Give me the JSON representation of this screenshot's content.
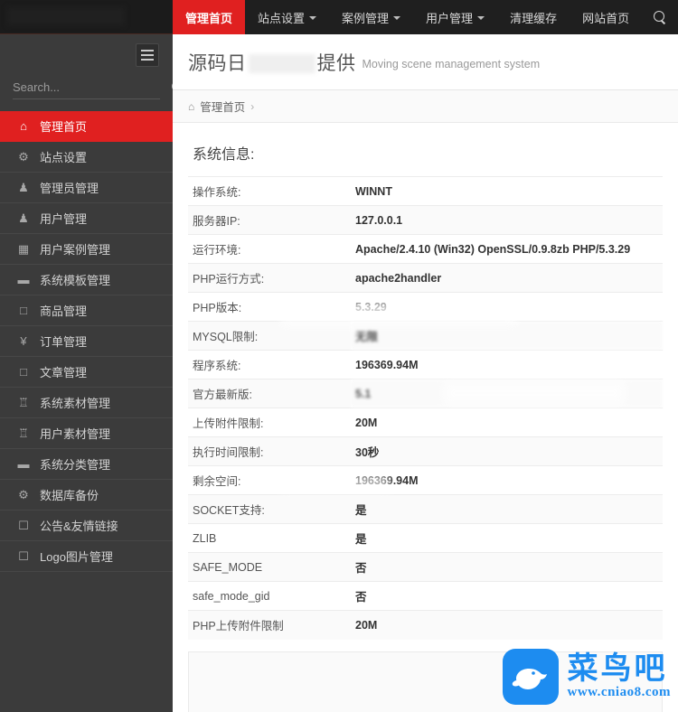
{
  "brand": {
    "accent": "#e02020",
    "sidebar_bg": "#3b3b3b",
    "topnav_bg": "#1f1f1f",
    "watermark_blue": "#1d8cf0"
  },
  "sidebar": {
    "search_placeholder": "Search...",
    "menu": [
      {
        "label": "管理首页",
        "icon": "home-icon",
        "glyph": "⌂",
        "active": true
      },
      {
        "label": "站点设置",
        "icon": "gears-icon",
        "glyph": "⚙",
        "active": false
      },
      {
        "label": "管理员管理",
        "icon": "user-icon",
        "glyph": "♟",
        "active": false
      },
      {
        "label": "用户管理",
        "icon": "user-icon",
        "glyph": "♟",
        "active": false
      },
      {
        "label": "用户案例管理",
        "icon": "grid-icon",
        "glyph": "▦",
        "active": false
      },
      {
        "label": "系统模板管理",
        "icon": "briefcase-icon",
        "glyph": "▬",
        "active": false
      },
      {
        "label": "商品管理",
        "icon": "box-caret-icon",
        "glyph": "□",
        "active": false
      },
      {
        "label": "订单管理",
        "icon": "yen-icon",
        "glyph": "¥",
        "active": false
      },
      {
        "label": "文章管理",
        "icon": "box-caret-icon",
        "glyph": "□",
        "active": false
      },
      {
        "label": "系统素材管理",
        "icon": "trophy-icon",
        "glyph": "♖",
        "active": false
      },
      {
        "label": "用户素材管理",
        "icon": "trophy-icon",
        "glyph": "♖",
        "active": false
      },
      {
        "label": "系统分类管理",
        "icon": "briefcase-icon",
        "glyph": "▬",
        "active": false
      },
      {
        "label": "数据库备份",
        "icon": "gears-icon",
        "glyph": "⚙",
        "active": false
      },
      {
        "label": "公告&友情链接",
        "icon": "bookmark-icon",
        "glyph": "☐",
        "active": false
      },
      {
        "label": "Logo图片管理",
        "icon": "bookmark-icon",
        "glyph": "☐",
        "active": false
      }
    ]
  },
  "topnav": {
    "items": [
      {
        "label": "管理首页",
        "active": true,
        "caret": false
      },
      {
        "label": "站点设置",
        "active": false,
        "caret": true
      },
      {
        "label": "案例管理",
        "active": false,
        "caret": true
      },
      {
        "label": "用户管理",
        "active": false,
        "caret": true
      },
      {
        "label": "清理缓存",
        "active": false,
        "caret": false
      },
      {
        "label": "网站首页",
        "active": false,
        "caret": false
      }
    ],
    "search_icon": "search-icon"
  },
  "header": {
    "title_prefix": "源码日",
    "title_suffix": "提供",
    "subtitle": "Moving scene management system"
  },
  "breadcrumb": {
    "home_icon": "home-icon",
    "label": "管理首页",
    "separator": "›"
  },
  "main": {
    "panel_title": "系统信息:",
    "rows": [
      {
        "key": "操作系统:",
        "value": "WINNT",
        "blurred": false
      },
      {
        "key": "服务器IP:",
        "value": "127.0.0.1",
        "blurred": false
      },
      {
        "key": "运行环境:",
        "value": "Apache/2.4.10 (Win32) OpenSSL/0.9.8zb PHP/5.3.29",
        "blurred": false
      },
      {
        "key": "PHP运行方式:",
        "value": "apache2handler",
        "blurred": false
      },
      {
        "key": "PHP版本:",
        "value": "5.3.29",
        "blurred": false
      },
      {
        "key": "MYSQL限制:",
        "value": "无限",
        "blurred": true
      },
      {
        "key": "程序系统:",
        "value": "196369.94M",
        "blurred": false
      },
      {
        "key": "官方最新版:",
        "value": "5.1",
        "blurred": true
      },
      {
        "key": "上传附件限制:",
        "value": "20M",
        "blurred": false
      },
      {
        "key": "执行时间限制:",
        "value": "30秒",
        "blurred": false
      },
      {
        "key": "剩余空间:",
        "value": "196369.94M",
        "blurred": false
      },
      {
        "key": "SOCKET支持:",
        "value": "是",
        "blurred": false
      },
      {
        "key": "ZLIB",
        "value": "是",
        "blurred": false
      },
      {
        "key": "SAFE_MODE",
        "value": "否",
        "blurred": false
      },
      {
        "key": "safe_mode_gid",
        "value": "否",
        "blurred": false
      },
      {
        "key": "PHP上传附件限制",
        "value": "20M",
        "blurred": false
      }
    ]
  },
  "watermark": {
    "name": "菜鸟吧",
    "url": "www.cniao8.com",
    "logo_icon": "bird-logo-icon"
  }
}
